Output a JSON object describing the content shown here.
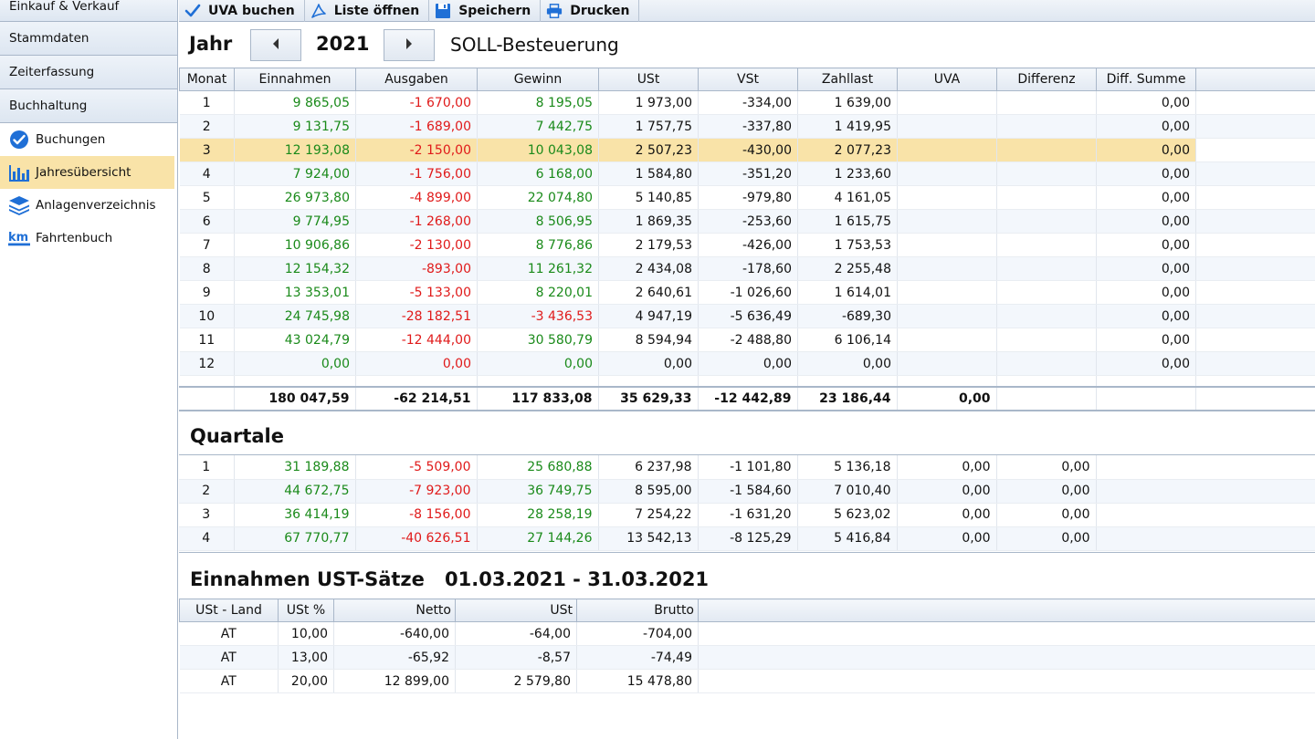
{
  "sidebar": {
    "groups": [
      "Einkauf & Verkauf",
      "Stammdaten",
      "Zeiterfassung",
      "Buchhaltung"
    ],
    "items": [
      {
        "label": "Buchungen",
        "icon": "check-circle-icon"
      },
      {
        "label": "Jahresübersicht",
        "icon": "bar-chart-icon"
      },
      {
        "label": "Anlagenverzeichnis",
        "icon": "layers-icon"
      },
      {
        "label": "Fahrtenbuch",
        "icon": "km-icon"
      }
    ]
  },
  "toolbar": {
    "uva_label": "UVA buchen",
    "open_list_label": "Liste öffnen",
    "save_label": "Speichern",
    "print_label": "Drucken"
  },
  "year_bar": {
    "label": "Jahr",
    "year": "2021",
    "mode": "SOLL-Besteuerung"
  },
  "monthly": {
    "headers": [
      "Monat",
      "Einnahmen",
      "Ausgaben",
      "Gewinn",
      "USt",
      "VSt",
      "Zahllast",
      "UVA",
      "Differenz",
      "Diff. Summe"
    ],
    "selected_month": "3",
    "rows": [
      [
        "1",
        "9 865,05",
        "-1 670,00",
        "8 195,05",
        "1 973,00",
        "-334,00",
        "1 639,00",
        "",
        "",
        "0,00"
      ],
      [
        "2",
        "9 131,75",
        "-1 689,00",
        "7 442,75",
        "1 757,75",
        "-337,80",
        "1 419,95",
        "",
        "",
        "0,00"
      ],
      [
        "3",
        "12 193,08",
        "-2 150,00",
        "10 043,08",
        "2 507,23",
        "-430,00",
        "2 077,23",
        "",
        "",
        "0,00"
      ],
      [
        "4",
        "7 924,00",
        "-1 756,00",
        "6 168,00",
        "1 584,80",
        "-351,20",
        "1 233,60",
        "",
        "",
        "0,00"
      ],
      [
        "5",
        "26 973,80",
        "-4 899,00",
        "22 074,80",
        "5 140,85",
        "-979,80",
        "4 161,05",
        "",
        "",
        "0,00"
      ],
      [
        "6",
        "9 774,95",
        "-1 268,00",
        "8 506,95",
        "1 869,35",
        "-253,60",
        "1 615,75",
        "",
        "",
        "0,00"
      ],
      [
        "7",
        "10 906,86",
        "-2 130,00",
        "8 776,86",
        "2 179,53",
        "-426,00",
        "1 753,53",
        "",
        "",
        "0,00"
      ],
      [
        "8",
        "12 154,32",
        "-893,00",
        "11 261,32",
        "2 434,08",
        "-178,60",
        "2 255,48",
        "",
        "",
        "0,00"
      ],
      [
        "9",
        "13 353,01",
        "-5 133,00",
        "8 220,01",
        "2 640,61",
        "-1 026,60",
        "1 614,01",
        "",
        "",
        "0,00"
      ],
      [
        "10",
        "24 745,98",
        "-28 182,51",
        "-3 436,53",
        "4 947,19",
        "-5 636,49",
        "-689,30",
        "",
        "",
        "0,00"
      ],
      [
        "11",
        "43 024,79",
        "-12 444,00",
        "30 580,79",
        "8 594,94",
        "-2 488,80",
        "6 106,14",
        "",
        "",
        "0,00"
      ],
      [
        "12",
        "0,00",
        "0,00",
        "0,00",
        "0,00",
        "0,00",
        "0,00",
        "",
        "",
        "0,00"
      ]
    ],
    "totals": [
      "",
      "180 047,59",
      "-62 214,51",
      "117 833,08",
      "35 629,33",
      "-12 442,89",
      "23 186,44",
      "0,00",
      "",
      ""
    ]
  },
  "quarters": {
    "title": "Quartale",
    "rows": [
      [
        "1",
        "31 189,88",
        "-5 509,00",
        "25 680,88",
        "6 237,98",
        "-1 101,80",
        "5 136,18",
        "0,00",
        "0,00"
      ],
      [
        "2",
        "44 672,75",
        "-7 923,00",
        "36 749,75",
        "8 595,00",
        "-1 584,60",
        "7 010,40",
        "0,00",
        "0,00"
      ],
      [
        "3",
        "36 414,19",
        "-8 156,00",
        "28 258,19",
        "7 254,22",
        "-1 631,20",
        "5 623,02",
        "0,00",
        "0,00"
      ],
      [
        "4",
        "67 770,77",
        "-40 626,51",
        "27 144,26",
        "13 542,13",
        "-8 125,29",
        "5 416,84",
        "0,00",
        "0,00"
      ]
    ]
  },
  "vat_rates": {
    "title": "Einnahmen UST-Sätze",
    "period": "01.03.2021 - 31.03.2021",
    "headers": [
      "USt - Land",
      "USt %",
      "Netto",
      "USt",
      "Brutto"
    ],
    "rows": [
      [
        "AT",
        "10,00",
        "-640,00",
        "-64,00",
        "-704,00"
      ],
      [
        "AT",
        "13,00",
        "-65,92",
        "-8,57",
        "-74,49"
      ],
      [
        "AT",
        "20,00",
        "12 899,00",
        "2 579,80",
        "15 478,80"
      ]
    ]
  },
  "colors": {
    "positive": "#1a8a1a",
    "negative": "#e01a1a",
    "selected_row": "#f9e3a8",
    "accent": "#1f6fd6"
  }
}
